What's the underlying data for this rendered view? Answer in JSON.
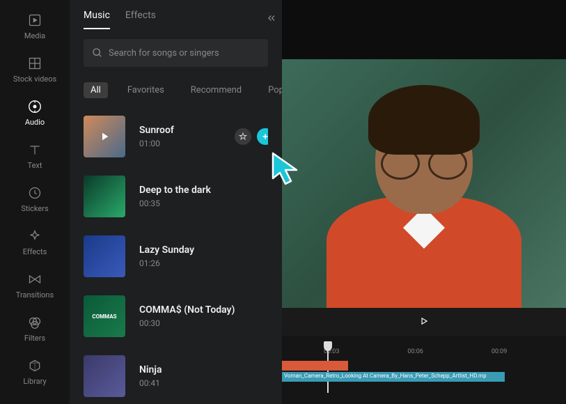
{
  "sidebar": {
    "items": [
      {
        "label": "Media",
        "icon": "play-square"
      },
      {
        "label": "Stock videos",
        "icon": "grid"
      },
      {
        "label": "Audio",
        "icon": "music-disc",
        "active": true
      },
      {
        "label": "Text",
        "icon": "text"
      },
      {
        "label": "Stickers",
        "icon": "clock"
      },
      {
        "label": "Effects",
        "icon": "sparkle"
      },
      {
        "label": "Transitions",
        "icon": "bowtie"
      },
      {
        "label": "Filters",
        "icon": "venn"
      },
      {
        "label": "Library",
        "icon": "cube"
      }
    ]
  },
  "panel": {
    "tabs": [
      {
        "label": "Music",
        "active": true
      },
      {
        "label": "Effects"
      }
    ],
    "search_placeholder": "Search for songs or singers",
    "filters": [
      {
        "label": "All",
        "active": true
      },
      {
        "label": "Favorites"
      },
      {
        "label": "Recommend"
      },
      {
        "label": "Pop"
      }
    ],
    "tracks": [
      {
        "title": "Sunroof",
        "duration": "01:00",
        "thumb_colors": [
          "#d08a5a",
          "#4a6a8a"
        ],
        "selected": true
      },
      {
        "title": "Deep to the dark",
        "duration": "00:35",
        "thumb_colors": [
          "#0a3a2a",
          "#2aaa6a"
        ]
      },
      {
        "title": "Lazy Sunday",
        "duration": "01:26",
        "thumb_colors": [
          "#1a3a8a",
          "#3a5aba"
        ]
      },
      {
        "title": "COMMA$ (Not Today)",
        "duration": "00:30",
        "thumb_colors": [
          "#0a5a3a",
          "#1a7a4a"
        ],
        "thumb_text": "COMMAS"
      },
      {
        "title": "Ninja",
        "duration": "00:41",
        "thumb_colors": [
          "#3a3a6a",
          "#5a5a9a"
        ]
      }
    ]
  },
  "timeline": {
    "marks": [
      "00:03",
      "00:06",
      "00:09"
    ],
    "audio_clip_label": "Voman_Camera_Retro_Looking At Camera_By_Hans_Peter_Schepp_Artlist_HD.mp"
  },
  "colors": {
    "accent": "#1bc6d9"
  }
}
